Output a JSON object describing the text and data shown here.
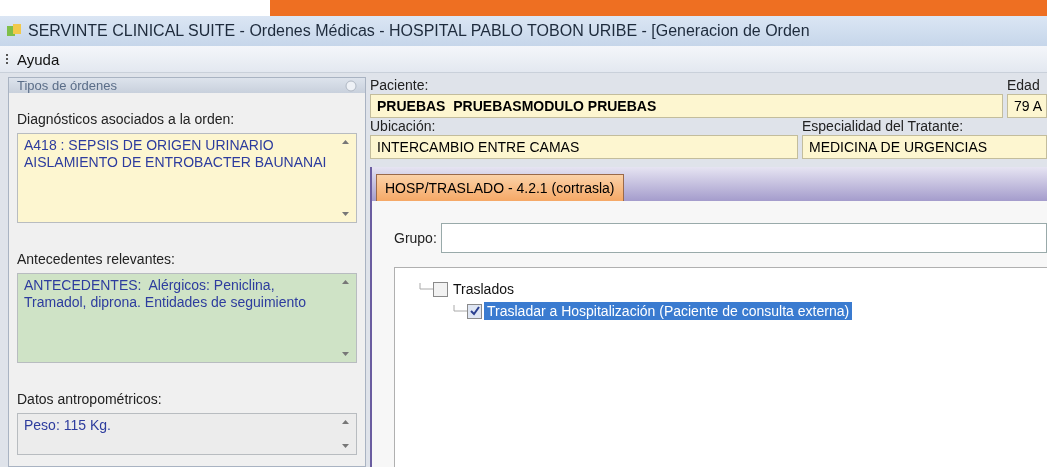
{
  "window": {
    "title": "SERVINTE CLINICAL SUITE - Ordenes Médicas - HOSPITAL PABLO TOBON URIBE - [Generacion de Orden"
  },
  "menu": [
    {
      "label": "Ayuda"
    }
  ],
  "sidebar": {
    "title": "Tipos de órdenes",
    "sections": [
      {
        "label": "Diagnósticos asociados a la orden:",
        "text": "A418 : SEPSIS DE ORIGEN URINARIO AISLAMIENTO DE ENTROBACTER BAUNANAI",
        "color": "#fdf6d0"
      },
      {
        "label": "Antecedentes relevantes:",
        "text": "ANTECEDENTES:  Alérgicos: Peniclina, Tramadol, diprona. Entidades de seguimiento",
        "color": "#cfe3c6"
      },
      {
        "label": "Datos antropométricos:",
        "text": "Peso: 115 Kg.",
        "color": "#ececec"
      }
    ]
  },
  "patient": {
    "name_label": "Paciente:",
    "name": "PRUEBAS  PRUEBASMODULO PRUEBAS",
    "age_label": "Edad",
    "age": "79 A",
    "location_label": "Ubicación:",
    "location": "INTERCAMBIO ENTRE CAMAS",
    "specialty_label": "Especialidad del Tratante:",
    "specialty": "MEDICINA DE URGENCIAS"
  },
  "tabs": [
    {
      "label": "HOSP/TRASLADO - 4.2.1 (cortrasla)",
      "selected": true
    }
  ],
  "group": {
    "label": "Grupo:"
  },
  "tree": [
    {
      "label": "Traslados",
      "checked": false,
      "selected": false,
      "children": [
        {
          "label": "Trasladar a Hospitalización (Paciente de consulta externa)",
          "checked": true,
          "selected": true
        }
      ]
    }
  ]
}
